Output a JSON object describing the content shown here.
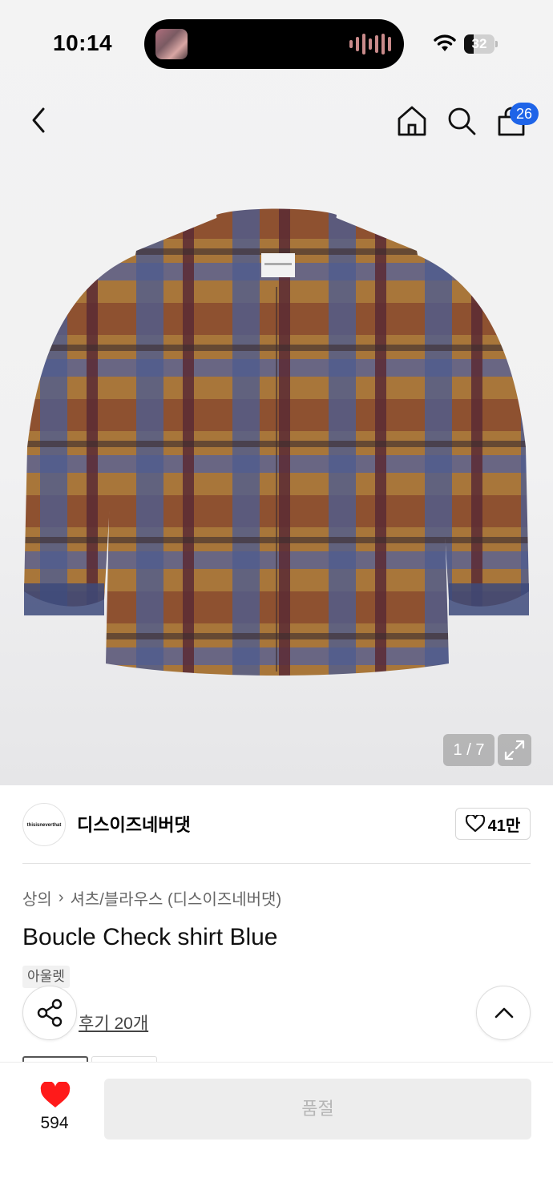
{
  "status_bar": {
    "time": "10:14",
    "battery": "32",
    "battery_level": 0.32
  },
  "nav": {
    "cart_count": "26"
  },
  "gallery": {
    "pager": "1 / 7"
  },
  "brand": {
    "logo_text": "thisisneverthat",
    "name": "디스이즈네버댓",
    "likes": "41만"
  },
  "product": {
    "breadcrumb": [
      "상의",
      "셔츠/블라우스 (디스이즈네버댓)"
    ],
    "title": "Boucle Check shirt Blue",
    "tag": "아울렛",
    "reviews": "후기 20개"
  },
  "bottom": {
    "like_count": "594",
    "buy_label": "품절"
  },
  "colors": {
    "accent": "#1e64e8",
    "heart": "#ff1a1a"
  },
  "icons": [
    "back-icon",
    "home-icon",
    "search-icon",
    "bag-icon",
    "expand-icon",
    "share-icon",
    "chevron-up-icon",
    "heart-icon",
    "wifi-icon"
  ]
}
